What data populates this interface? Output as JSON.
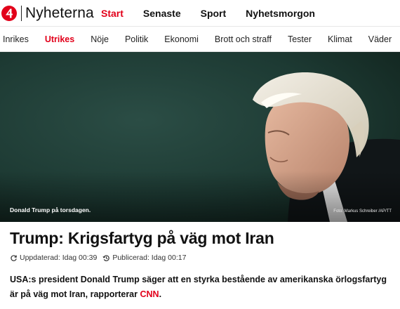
{
  "header": {
    "logo_text": "Nyheterna",
    "brand_color": "#e2001a",
    "nav": [
      {
        "label": "Start",
        "active": true
      },
      {
        "label": "Senaste",
        "active": false
      },
      {
        "label": "Sport",
        "active": false
      },
      {
        "label": "Nyhetsmorgon",
        "active": false
      }
    ]
  },
  "subnav": [
    {
      "label": "Inrikes",
      "active": false
    },
    {
      "label": "Utrikes",
      "active": true
    },
    {
      "label": "Nöje",
      "active": false
    },
    {
      "label": "Politik",
      "active": false
    },
    {
      "label": "Ekonomi",
      "active": false
    },
    {
      "label": "Brott och straff",
      "active": false
    },
    {
      "label": "Tester",
      "active": false
    },
    {
      "label": "Klimat",
      "active": false
    },
    {
      "label": "Väder",
      "active": false
    }
  ],
  "hero": {
    "caption": "Donald Trump på torsdagen.",
    "credit": "Foto: Markus Schreiber /AP/TT"
  },
  "article": {
    "headline": "Trump: Krigsfartyg på väg mot Iran",
    "updated": "Uppdaterad: Idag 00:39",
    "published": "Publicerad: Idag 00:17",
    "lead_text": "USA:s president Donald Trump säger att en styrka bestående av amerikanska örlogsfartyg är på väg mot Iran, rapporterar ",
    "lead_link": "CNN",
    "lead_end": "."
  }
}
